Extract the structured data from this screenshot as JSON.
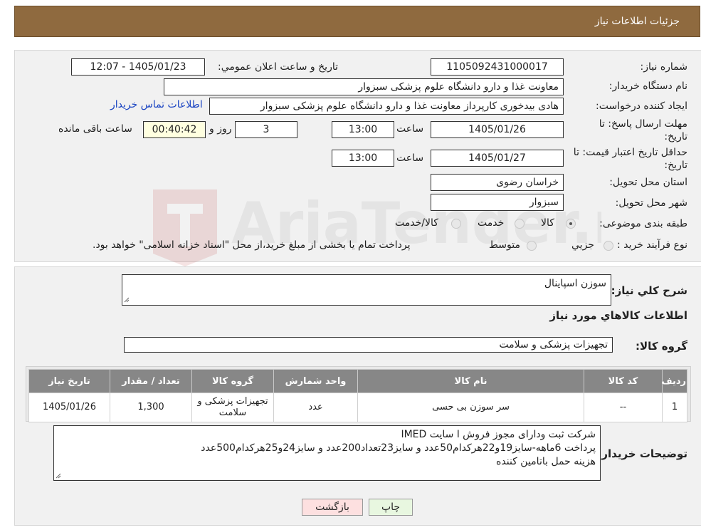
{
  "header": {
    "title": "جزئیات اطلاعات نیاز"
  },
  "form": {
    "need_number_label": "شماره نیاز:",
    "need_number": "1105092431000017",
    "announce_label": "تاریخ و ساعت اعلان عمومي:",
    "announce_value": "1405/01/23 - 12:07",
    "buyer_org_label": "نام دستگاه خریدار:",
    "buyer_org": "معاونت غذا و دارو   دانشگاه علوم پزشکی سبزوار",
    "requester_label": "ایجاد کننده درخواست:",
    "requester": "هادی بیدخوری کارپرداز معاونت غذا و دارو   دانشگاه علوم پزشکی سبزوار",
    "contact_link": "اطلاعات تماس خریدار",
    "deadline_label_1": "مهلت ارسال پاسخ: تا",
    "deadline_label_2": "تاریخ:",
    "deadline_date": "1405/01/26",
    "time_label": "ساعت",
    "deadline_time": "13:00",
    "days_value": "3",
    "days_label": "روز و",
    "remaining_time": "00:40:42",
    "remaining_label": "ساعت باقی مانده",
    "validity_label_1": "حداقل تاریخ اعتبار قیمت: تا",
    "validity_label_2": "تاریخ:",
    "validity_date": "1405/01/27",
    "validity_time_label": "ساعت",
    "validity_time": "13:00",
    "province_label": "استان محل تحویل:",
    "province": "خراسان رضوی",
    "city_label": "شهر محل تحویل:",
    "city": "سبزوار",
    "category_label": "طبقه بندی موضوعی:",
    "category_options": [
      "کالا",
      "خدمت",
      "کالا/خدمت"
    ],
    "process_label": "نوع فرآیند خرید :",
    "process_options": [
      "جزیي",
      "متوسط"
    ],
    "process_note": "پرداخت تمام یا بخشی از مبلغ خرید،از محل \"اسناد خزانه اسلامی\" خواهد بود."
  },
  "summary": {
    "desc_label": "شرح كلي نياز:",
    "desc_value": "سوزن اسپاینال",
    "goods_info_title": "اطلاعات كالاهاي مورد نياز",
    "goods_group_label": "گروه كالا:",
    "goods_group_value": "تجهیزات پزشکی و سلامت"
  },
  "table": {
    "headers": [
      "رديف",
      "كد كالا",
      "نام كالا",
      "واحد شمارش",
      "گروه كالا",
      "تعداد / مقدار",
      "تاریخ نیاز"
    ],
    "rows": [
      [
        "1",
        "--",
        "سر سوزن بی حسی",
        "عدد",
        "تجهیزات پزشکی و سلامت",
        "1,300",
        "1405/01/26"
      ]
    ]
  },
  "buyer_notes": {
    "label": "توضیحات خریدار:",
    "lines": [
      "شرکت ثبت ودارای مجوز فروش ا سایت IMED",
      "پرداخت 6ماهه-سایز19و22هرکدام50عدد و سایز23تعداد200عدد و سایز24و25هرکدام500عدد",
      "هزینه حمل باتامین کننده"
    ]
  },
  "buttons": {
    "print": "چاپ",
    "back": "بازگشت"
  },
  "colors": {
    "header_bg": "#8f6a3f",
    "table_header_bg": "#878787",
    "link": "#1a44c2",
    "back_btn": "#fde0e0",
    "print_btn": "#e8f7e0"
  }
}
